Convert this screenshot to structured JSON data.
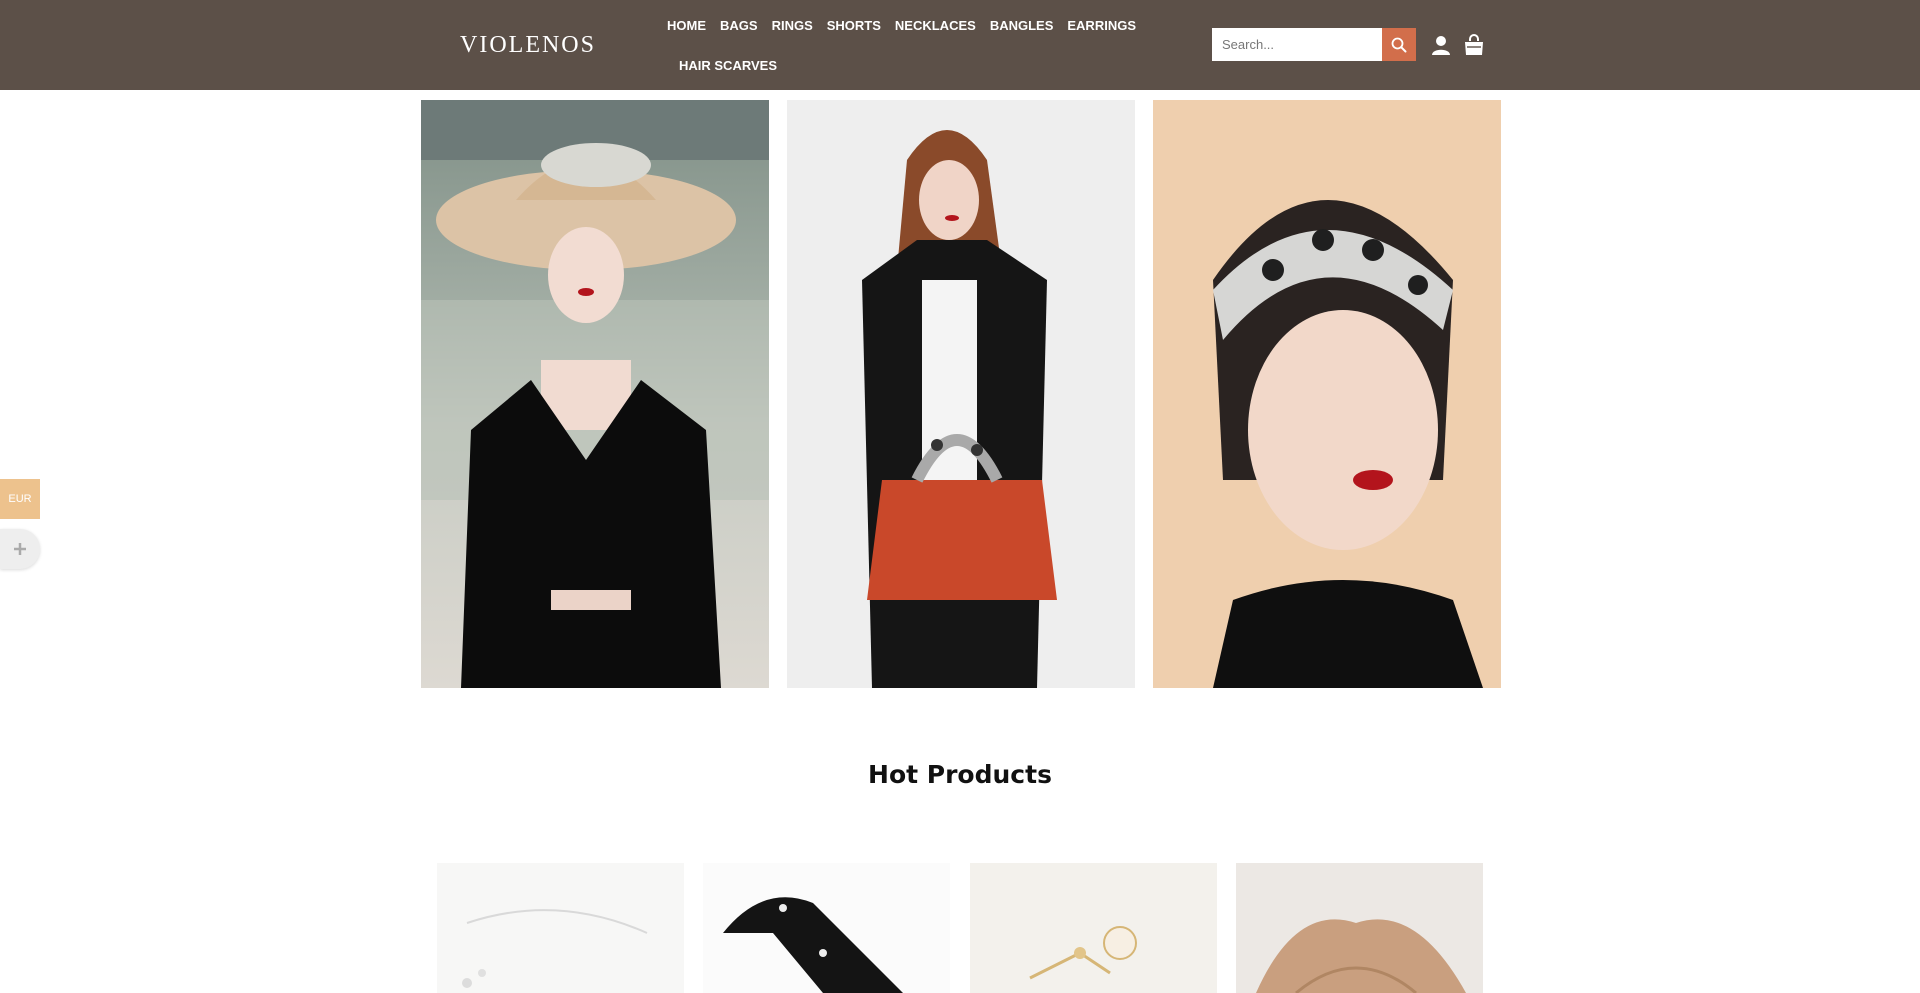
{
  "header": {
    "logo": "VIOLENOS",
    "nav_row1": [
      "HOME",
      "BAGS",
      "RINGS",
      "SHORTS",
      "NECKLACES",
      "BANGLES",
      "EARRINGS"
    ],
    "nav_row2": [
      "HAIR SCARVES"
    ],
    "search_placeholder": "Search...",
    "icons": [
      "search-icon",
      "user-icon",
      "shopping-bag-icon"
    ]
  },
  "hero": {
    "images": [
      "woman-wide-brim-hat-black-dress",
      "woman-red-handbag-polka-scarf",
      "woman-polka-dot-headband"
    ]
  },
  "side_widgets": {
    "currency": "EUR",
    "plus_icon": "plus-icon"
  },
  "section": {
    "title": "Hot Products"
  },
  "products": [
    "crystal-hair-chain",
    "black-bandana-scarf",
    "gold-flower-hair-comb",
    "beige-knit-scarf"
  ],
  "colors": {
    "header_bg": "#5c5048",
    "search_button": "#d26e4b",
    "currency_badge": "#edc28d"
  }
}
